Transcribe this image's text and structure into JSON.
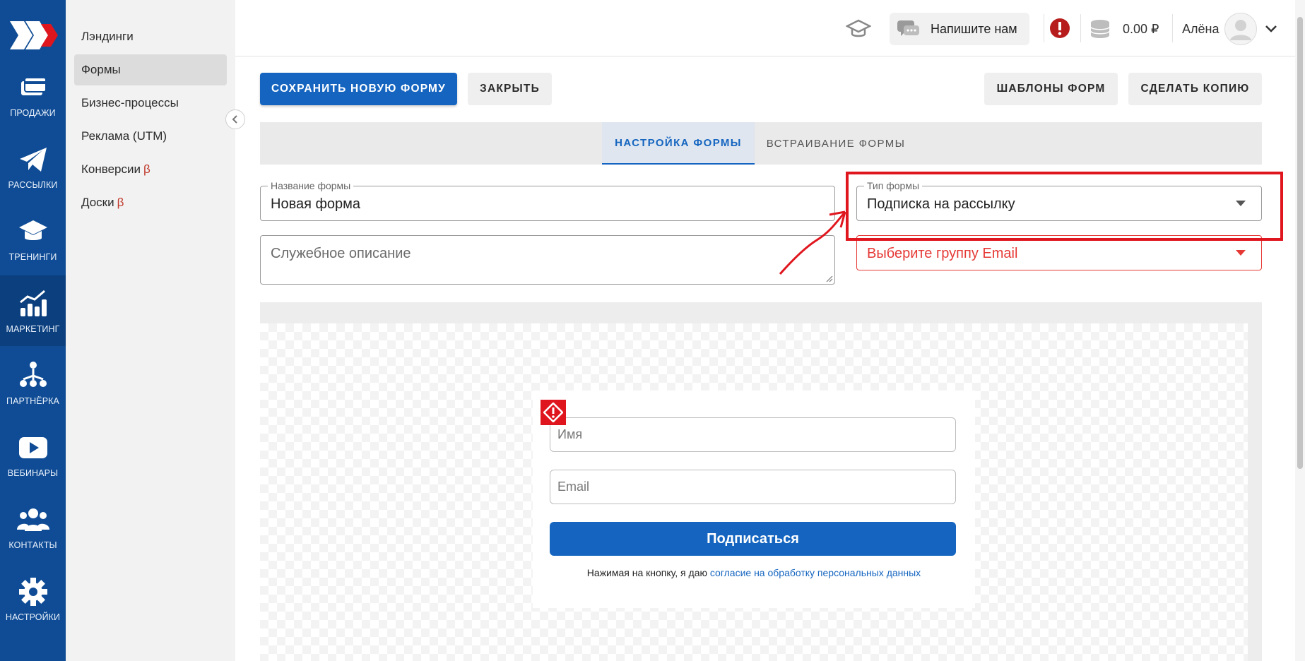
{
  "rail": {
    "items": [
      {
        "label": "ПРОДАЖИ",
        "icon": "card-icon"
      },
      {
        "label": "РАССЫЛКИ",
        "icon": "paper-plane-icon"
      },
      {
        "label": "ТРЕНИНГИ",
        "icon": "graduation-cap-icon"
      },
      {
        "label": "МАРКЕТИНГ",
        "icon": "growth-chart-icon"
      },
      {
        "label": "ПАРТНЁРКА",
        "icon": "network-icon"
      },
      {
        "label": "ВЕБИНАРЫ",
        "icon": "play-icon"
      },
      {
        "label": "КОНТАКТЫ",
        "icon": "users-icon"
      },
      {
        "label": "НАСТРОЙКИ",
        "icon": "gear-icon"
      }
    ],
    "active_index": 3
  },
  "subnav": {
    "items": [
      {
        "label": "Лэндинги",
        "beta": ""
      },
      {
        "label": "Формы",
        "beta": ""
      },
      {
        "label": "Бизнес-процессы",
        "beta": ""
      },
      {
        "label": "Реклама (UTM)",
        "beta": ""
      },
      {
        "label": "Конверсии",
        "beta": "β"
      },
      {
        "label": "Доски",
        "beta": "β"
      }
    ],
    "active_index": 1
  },
  "header": {
    "chat_label": "Напишите нам",
    "balance": "0.00 ₽",
    "user_name": "Алёна"
  },
  "toolbar": {
    "save_label": "СОХРАНИТЬ НОВУЮ ФОРМУ",
    "close_label": "ЗАКРЫТЬ",
    "templates_label": "ШАБЛОНЫ ФОРМ",
    "copy_label": "СДЕЛАТЬ КОПИЮ"
  },
  "tabs": [
    {
      "label": "НАСТРОЙКА ФОРМЫ",
      "active": true
    },
    {
      "label": "ВСТРАИВАНИЕ ФОРМЫ",
      "active": false
    }
  ],
  "form_settings": {
    "name_label": "Название формы",
    "name_value": "Новая форма",
    "description_placeholder": "Служебное описание",
    "type_label": "Тип формы",
    "type_value": "Подписка на рассылку",
    "group_placeholder": "Выберите группу Email"
  },
  "preview": {
    "name_placeholder": "Имя",
    "email_placeholder": "Email",
    "submit_label": "Подписаться",
    "consent_text": "Нажимая на кнопку, я даю ",
    "consent_link": "согласие на обработку персональных данных"
  },
  "colors": {
    "brand_blue": "#1565c0",
    "rail_blue": "#0f4c95",
    "alert_red": "#e0161e",
    "error_red": "#e53935"
  }
}
